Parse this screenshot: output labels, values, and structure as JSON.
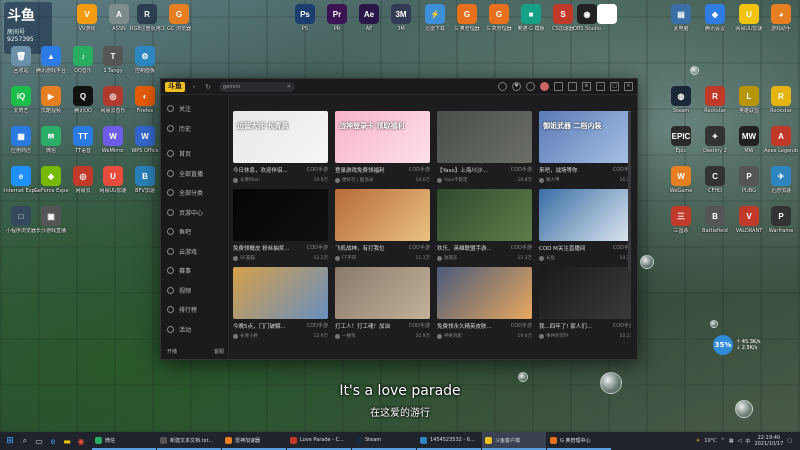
{
  "desktop": {
    "badge": {
      "brand": "斗鱼",
      "sub": "房间号",
      "num": "9257395"
    },
    "top_icons": [
      {
        "label": "WPS",
        "color": "#c0392b",
        "glyph": "W"
      },
      {
        "label": "VV游戏",
        "color": "#f39c12",
        "glyph": "V"
      },
      {
        "label": "ASSN",
        "color": "#7f8c8d",
        "glyph": "A"
      },
      {
        "label": "RGB注册机用工具",
        "color": "#2c3e50",
        "glyph": "R"
      },
      {
        "label": "GC 浏览器",
        "color": "#e67e22",
        "glyph": "G"
      },
      {
        "label": "PS",
        "color": "#1b3e6f",
        "glyph": "Ps"
      },
      {
        "label": "PR",
        "color": "#3b1454",
        "glyph": "Pr"
      },
      {
        "label": "AE",
        "color": "#2a1648",
        "glyph": "Ae"
      },
      {
        "label": "3M",
        "color": "#333a55",
        "glyph": "3M"
      },
      {
        "label": "迅雷下载",
        "color": "#3c8fd8",
        "glyph": "⚡"
      },
      {
        "label": "G 奥管理器",
        "color": "#e86f1c",
        "glyph": "G"
      },
      {
        "label": "G 高管理器",
        "color": "#e86f1c",
        "glyph": "G"
      },
      {
        "label": "奥德-G 模板",
        "color": "#16a085",
        "glyph": "■"
      },
      {
        "label": "CS加速器",
        "color": "#c0392b",
        "glyph": "S"
      },
      {
        "label": "OBS Studio",
        "color": "#222",
        "glyph": "◉"
      },
      {
        "label": "",
        "color": "#fff",
        "glyph": "♥"
      }
    ],
    "left_icons": [
      {
        "label": "回收站",
        "color": "#6b8fa8",
        "glyph": "🗑"
      },
      {
        "label": "腾讯游戏平台",
        "color": "#2c7be5",
        "glyph": "▲"
      },
      {
        "label": "QQ音乐",
        "color": "#27ae60",
        "glyph": "♪"
      },
      {
        "label": "1 Tangy",
        "color": "#555",
        "glyph": "T"
      },
      {
        "label": "控制面板",
        "color": "#2e86c1",
        "glyph": "⚙"
      },
      {
        "label": "爱奇艺",
        "color": "#1abc4a",
        "glyph": "iQ"
      },
      {
        "label": "优酷视频",
        "color": "#e67e22",
        "glyph": "▶"
      },
      {
        "label": "腾讯QQ",
        "color": "#111",
        "glyph": "Q"
      },
      {
        "label": "网易云音乐",
        "color": "#b03a2e",
        "glyph": "◎"
      },
      {
        "label": "Firefox",
        "color": "#e55b0a",
        "glyph": "◐"
      },
      {
        "label": "应用商店",
        "color": "#2a7ae2",
        "glyph": "▦"
      },
      {
        "label": "微信",
        "color": "#2aae67",
        "glyph": "✉"
      },
      {
        "label": "TT语音",
        "color": "#2a7ae2",
        "glyph": "TT"
      },
      {
        "label": "WeMirror",
        "color": "#6c5ce7",
        "glyph": "W"
      },
      {
        "label": "WPS Office",
        "color": "#3366cc",
        "glyph": "W"
      },
      {
        "label": "Internet Explorer",
        "color": "#1e90ff",
        "glyph": "e"
      },
      {
        "label": "GeForce Experience",
        "color": "#76b900",
        "glyph": "◆"
      },
      {
        "label": "网易云",
        "color": "#c0392b",
        "glyph": "◎"
      },
      {
        "label": "网易UU加速",
        "color": "#e74c3c",
        "glyph": "U"
      },
      {
        "label": "BFV加速",
        "color": "#2980b9",
        "glyph": "B"
      },
      {
        "label": "小程序浏览器",
        "color": "#34495e",
        "glyph": "□"
      },
      {
        "label": "长沙游戏直播",
        "color": "#555",
        "glyph": "▣"
      }
    ],
    "right_icons": [
      {
        "label": "此电脑",
        "color": "#3a6ea5",
        "glyph": "▤"
      },
      {
        "label": "腾讯会议",
        "color": "#2d7be3",
        "glyph": "◆"
      },
      {
        "label": "网易UU加速",
        "color": "#f1c40f",
        "glyph": "U"
      },
      {
        "label": "游戏助手",
        "color": "#e67e22",
        "glyph": "◕"
      },
      {
        "label": "Steam",
        "color": "#1b2838",
        "glyph": "◍"
      },
      {
        "label": "Rockstar",
        "color": "#c0392b",
        "glyph": "R"
      },
      {
        "label": "英雄联盟",
        "color": "#b7950b",
        "glyph": "L"
      },
      {
        "label": "Rockstar",
        "color": "#e5b410",
        "glyph": "R"
      },
      {
        "label": "Epic",
        "color": "#2b2b2b",
        "glyph": "EPIC"
      },
      {
        "label": "Destiny 2",
        "color": "#333",
        "glyph": "✦"
      },
      {
        "label": "MW",
        "color": "#222",
        "glyph": "MW"
      },
      {
        "label": "Apex Legends",
        "color": "#c0392b",
        "glyph": "A"
      },
      {
        "label": "WeGame",
        "color": "#e67e22",
        "glyph": "W"
      },
      {
        "label": "CFHD",
        "color": "#333",
        "glyph": "C"
      },
      {
        "label": "PUBG",
        "color": "#555",
        "glyph": "P"
      },
      {
        "label": "迅游加速",
        "color": "#2e86c1",
        "glyph": "✈"
      },
      {
        "label": "三国杀",
        "color": "#c0392b",
        "glyph": "三"
      },
      {
        "label": "Battlefield",
        "color": "#555",
        "glyph": "B"
      },
      {
        "label": "VALORANT",
        "color": "#c0392b",
        "glyph": "V"
      },
      {
        "label": "Warframe",
        "color": "#333",
        "glyph": "P"
      }
    ]
  },
  "app": {
    "logo": "斗鱼",
    "search_placeholder": "gemini",
    "search_clear": "✕",
    "sidebar": [
      {
        "label": "关注"
      },
      {
        "label": "历史"
      },
      {
        "label": "首页"
      },
      {
        "label": "全部直播"
      },
      {
        "label": "全部分类"
      },
      {
        "label": "页游中心"
      },
      {
        "label": "鱼吧"
      },
      {
        "label": "云游戏"
      },
      {
        "label": "赛事"
      },
      {
        "label": "视频"
      },
      {
        "label": "排行榜"
      },
      {
        "label": "活动"
      }
    ],
    "sidebar_bottom": {
      "left": "开播",
      "right": "客服"
    },
    "cards": [
      {
        "title": "今日休息，欢迎伴侣...",
        "category": "COD手游",
        "streamer": "长青Mian",
        "viewers": "19.9万",
        "bg1": "#e8e8e8",
        "bg2": "#f5f5f5",
        "overlay": "运营大师 长青高"
      },
      {
        "title": "登录游戏免费领福利",
        "category": "COD手游",
        "streamer": "便好社 | 酷洛米",
        "viewers": "14.6万",
        "bg1": "#f8b4c8",
        "bg2": "#fde0ea",
        "overlay": "战神登录卡 领取福利"
      },
      {
        "title": "【Yaso】上海川沙...",
        "category": "COD手游",
        "streamer": "Yaso不愿定",
        "viewers": "19.8万",
        "bg1": "#4a4f4a",
        "bg2": "#6a6e66",
        "overlay": ""
      },
      {
        "title": "来吧，战场等你",
        "category": "COD手游",
        "streamer": "路人甲",
        "viewers": "16.2万",
        "bg1": "#5b7bb6",
        "bg2": "#a9c1e6",
        "overlay": "御姐武器 二档内装"
      },
      {
        "title": "免费领概皮 粉丝抽奖...",
        "category": "COD手游",
        "streamer": "SC猫猫",
        "viewers": "12.2万",
        "bg1": "#050505",
        "bg2": "#111",
        "overlay": ""
      },
      {
        "title": "飞机战神，有打我位",
        "category": "COD手游",
        "streamer": "FF平哥",
        "viewers": "11.1万",
        "bg1": "#b86a3a",
        "bg2": "#e9c27f",
        "overlay": ""
      },
      {
        "title": "欢乐、英雄联盟手游...",
        "category": "COD手游",
        "streamer": "独孤东",
        "viewers": "12.3万",
        "bg1": "#2d4a2e",
        "bg2": "#5f7d49",
        "overlay": ""
      },
      {
        "title": "COD M关注直播间",
        "category": "COD手游",
        "streamer": "长鱼",
        "viewers": "10.2万",
        "bg1": "#3a6ea5",
        "bg2": "#e0e8f0",
        "overlay": ""
      },
      {
        "title": "今晚5点，门门破解...",
        "category": "COD手游",
        "streamer": "长青小胖",
        "viewers": "12.9万",
        "bg1": "#d4a04a",
        "bg2": "#6a8fbf",
        "overlay": ""
      },
      {
        "title": "打工人！打工魂！加油",
        "category": "COD手游",
        "streamer": "一楼哥",
        "viewers": "10.9万",
        "bg1": "#8a7a6a",
        "bg2": "#c2b29a",
        "overlay": ""
      },
      {
        "title": "免费领永久精英皮肤...",
        "category": "COD手游",
        "streamer": "神奇泡影",
        "viewers": "19.6万",
        "bg1": "#4a5a7a",
        "bg2": "#e8a860",
        "overlay": ""
      },
      {
        "title": "我...四年了! 家人们...",
        "category": "COD手游",
        "streamer": "事件的可怜",
        "viewers": "10.2万",
        "bg1": "#1a1a1a",
        "bg2": "#3a3a3a",
        "overlay": ""
      }
    ]
  },
  "subtitles": {
    "en": "It's a love parade",
    "zh": "在这爱的游行"
  },
  "overlay_stats": {
    "percent": "35%",
    "up": "↑ 45.3K/s",
    "down": "↓ 2.5K/s"
  },
  "taskbar": {
    "tasks": [
      {
        "label": "微信",
        "color": "#2aae67",
        "active": false
      },
      {
        "label": "新建文本文档.txt...",
        "color": "#555",
        "active": false
      },
      {
        "label": "雷神加速器",
        "color": "#e67e22",
        "active": false
      },
      {
        "label": "Love Parade - C...",
        "color": "#c0392b",
        "active": false
      },
      {
        "label": "Steam",
        "color": "#1b2838",
        "active": false
      },
      {
        "label": "1454523532 - 6...",
        "color": "#2e86c1",
        "active": false
      },
      {
        "label": "斗鱼客户端",
        "color": "#f0c020",
        "active": true
      },
      {
        "label": "G 奥管理中心",
        "color": "#e86f1c",
        "active": false
      }
    ],
    "weather": "10°C",
    "time": "22:19:40",
    "date": "2021/10/17"
  }
}
